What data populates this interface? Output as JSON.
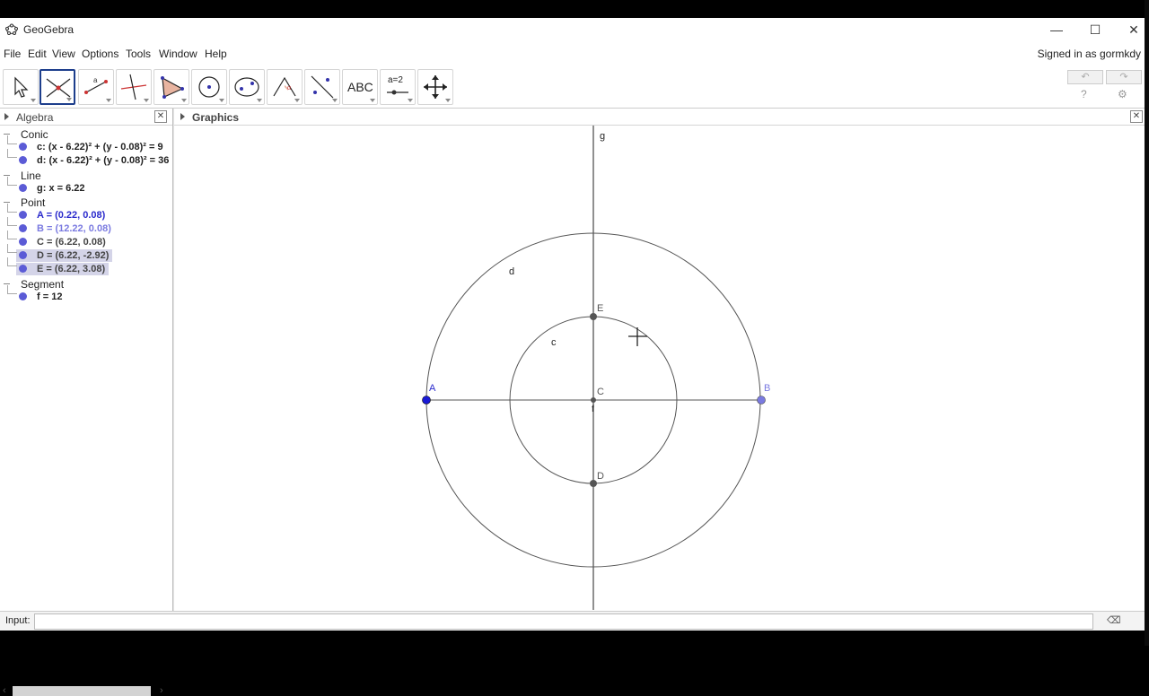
{
  "window": {
    "title": "GeoGebra",
    "minimize": "—",
    "maximize": "☐",
    "close": "✕"
  },
  "menu": {
    "items": [
      "File",
      "Edit",
      "View",
      "Options",
      "Tools",
      "Window",
      "Help"
    ],
    "signed_in": "Signed in as gormkdy"
  },
  "toolbar": {
    "text_tool": "ABC",
    "slider_tool": "a=2",
    "undo": "↶",
    "redo": "↷",
    "help": "?",
    "settings": "⚙"
  },
  "algebra": {
    "title": "Algebra",
    "categories": [
      {
        "name": "Conic",
        "items": [
          {
            "text": "c: (x - 6.22)² + (y - 0.08)² = 9",
            "color": "#4b4bd0",
            "highlight": false
          },
          {
            "text": "d: (x - 6.22)² + (y - 0.08)² = 36",
            "color": "#4b4bd0",
            "highlight": false
          }
        ]
      },
      {
        "name": "Line",
        "items": [
          {
            "text": "g: x = 6.22",
            "color": "#4b4bd0",
            "highlight": false
          }
        ]
      },
      {
        "name": "Point",
        "items": [
          {
            "text": "A = (0.22, 0.08)",
            "color": "#2a2acc",
            "highlight": false
          },
          {
            "text": "B = (12.22, 0.08)",
            "color": "#7a7ae0",
            "highlight": false
          },
          {
            "text": "C = (6.22, 0.08)",
            "color": "#444444",
            "highlight": false
          },
          {
            "text": "D = (6.22, -2.92)",
            "color": "#444444",
            "highlight": true
          },
          {
            "text": "E = (6.22, 3.08)",
            "color": "#444444",
            "highlight": true
          }
        ]
      },
      {
        "name": "Segment",
        "items": [
          {
            "text": "f = 12",
            "color": "#4b4bd0",
            "highlight": false
          }
        ]
      }
    ]
  },
  "graphics": {
    "title": "Graphics",
    "labels": {
      "g": "g",
      "d": "d",
      "c": "c",
      "E": "E",
      "C": "C",
      "D": "D",
      "A": "A",
      "B": "B",
      "f": "f"
    }
  },
  "input": {
    "label": "Input:",
    "value": ""
  }
}
